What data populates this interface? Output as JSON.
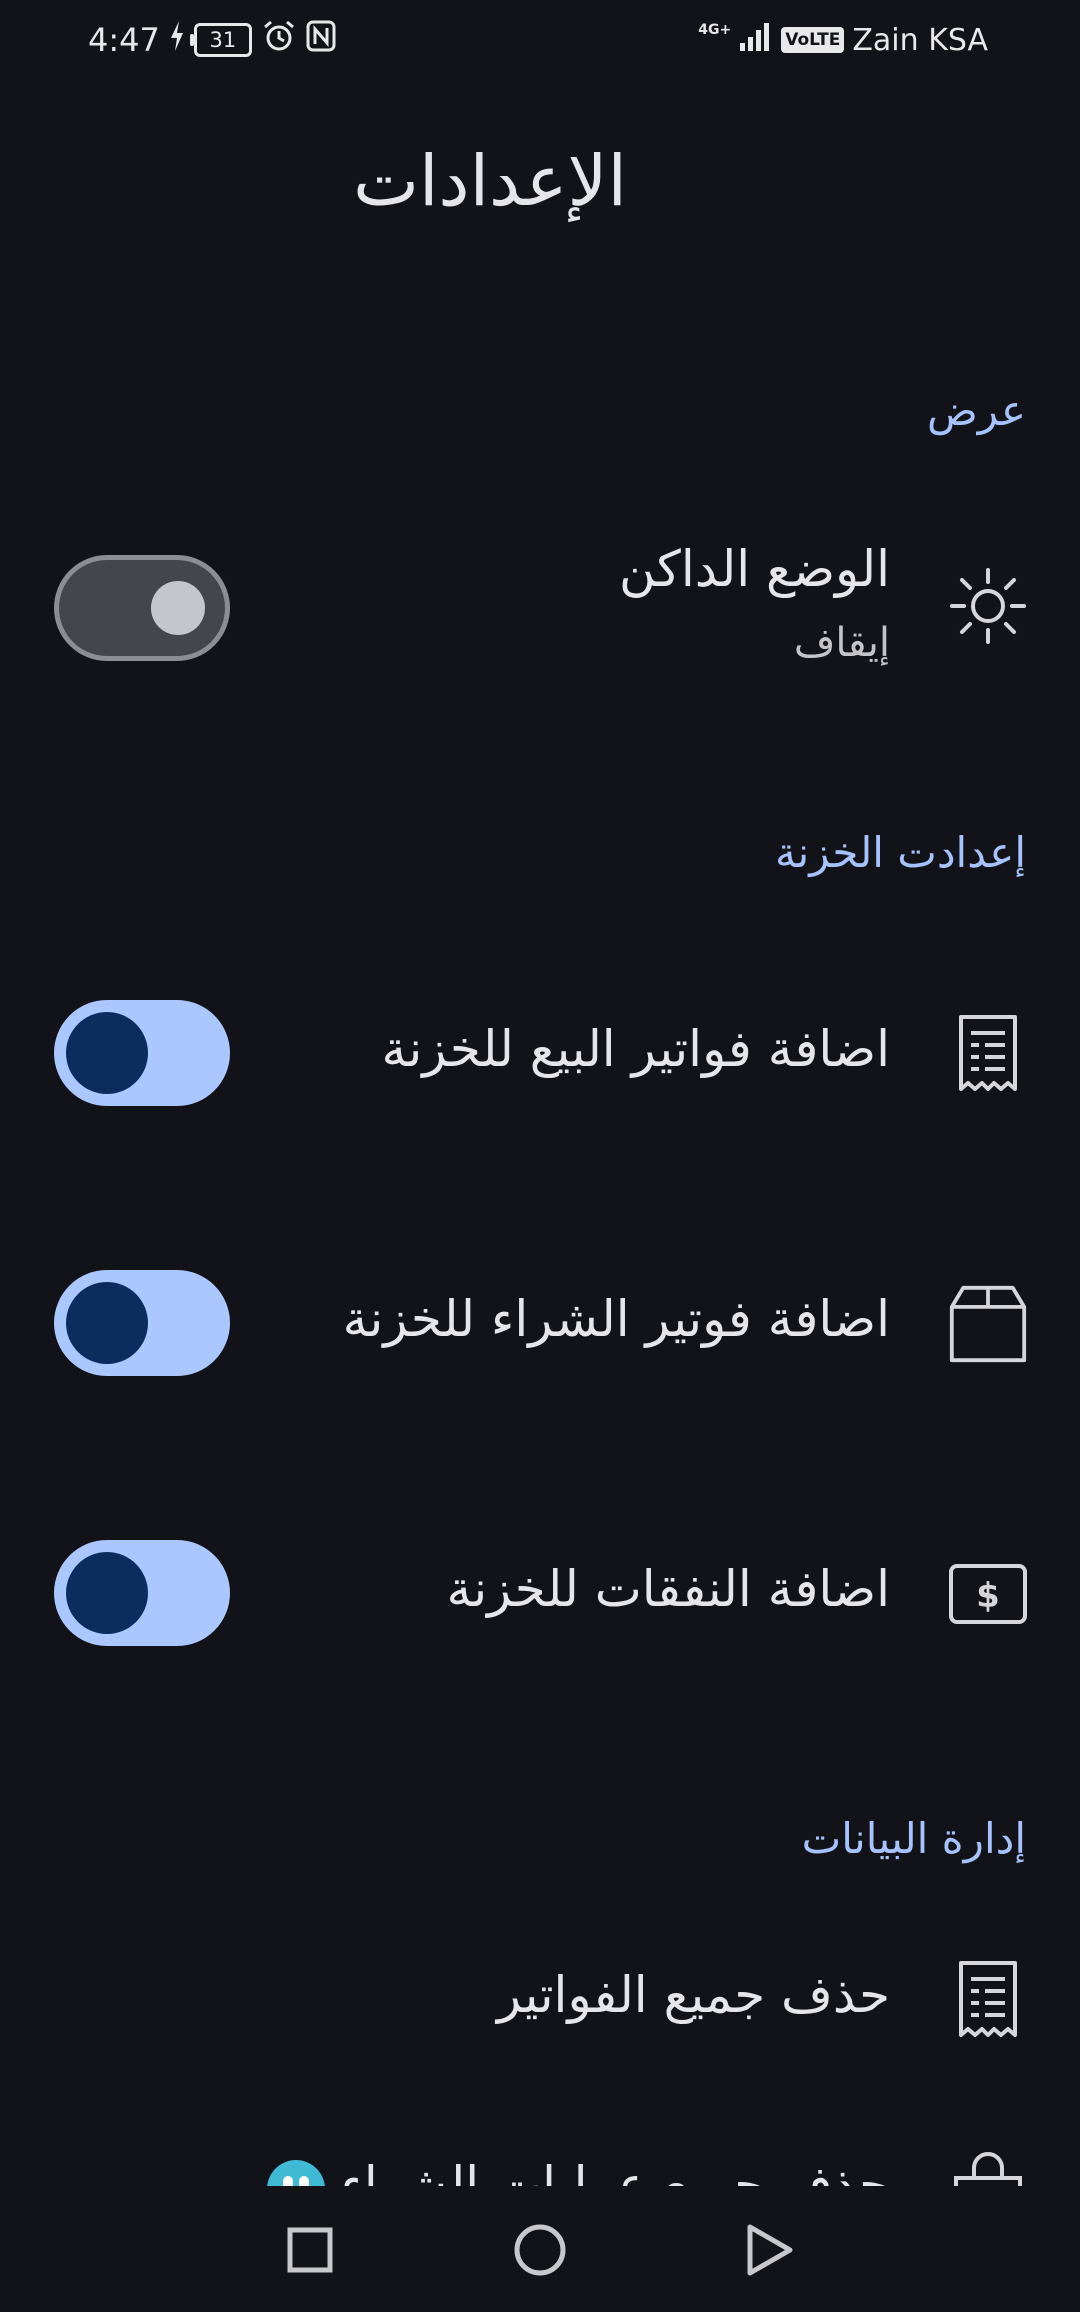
{
  "status_bar": {
    "time": "4:47",
    "battery": "31",
    "network": "4G+",
    "volte": "VoLTE",
    "carrier": "Zain KSA"
  },
  "page": {
    "title": "الإعدادات"
  },
  "sections": {
    "display": {
      "header": "عرض",
      "dark_mode": {
        "title": "الوضع الداكن",
        "subtitle": "إيقاف",
        "icon": "sun-icon",
        "enabled": false
      }
    },
    "treasury": {
      "header": "إعدادت الخزنة",
      "items": [
        {
          "title": "اضافة فواتير البيع للخزنة",
          "icon": "receipt-icon",
          "enabled": true
        },
        {
          "title": "اضافة فوتير الشراء للخزنة",
          "icon": "box-icon",
          "enabled": true
        },
        {
          "title": "اضافة النفقات للخزنة",
          "icon": "money-icon",
          "enabled": true
        }
      ]
    },
    "data_management": {
      "header": "إدارة البيانات",
      "items": [
        {
          "title": "حذف جميع الفواتير",
          "icon": "receipt-icon"
        },
        {
          "title": "حذف جميع عمليات الشراء",
          "icon": "shopping-bag-icon"
        }
      ]
    }
  },
  "colors": {
    "background": "#121318",
    "accent": "#a6c3ff",
    "toggle_on_track": "#abc7ff",
    "toggle_on_knob": "#0b2d5e",
    "toggle_off_track": "#44464d"
  },
  "nav": {
    "recents": "square-icon",
    "home": "circle-icon",
    "back": "triangle-icon"
  }
}
